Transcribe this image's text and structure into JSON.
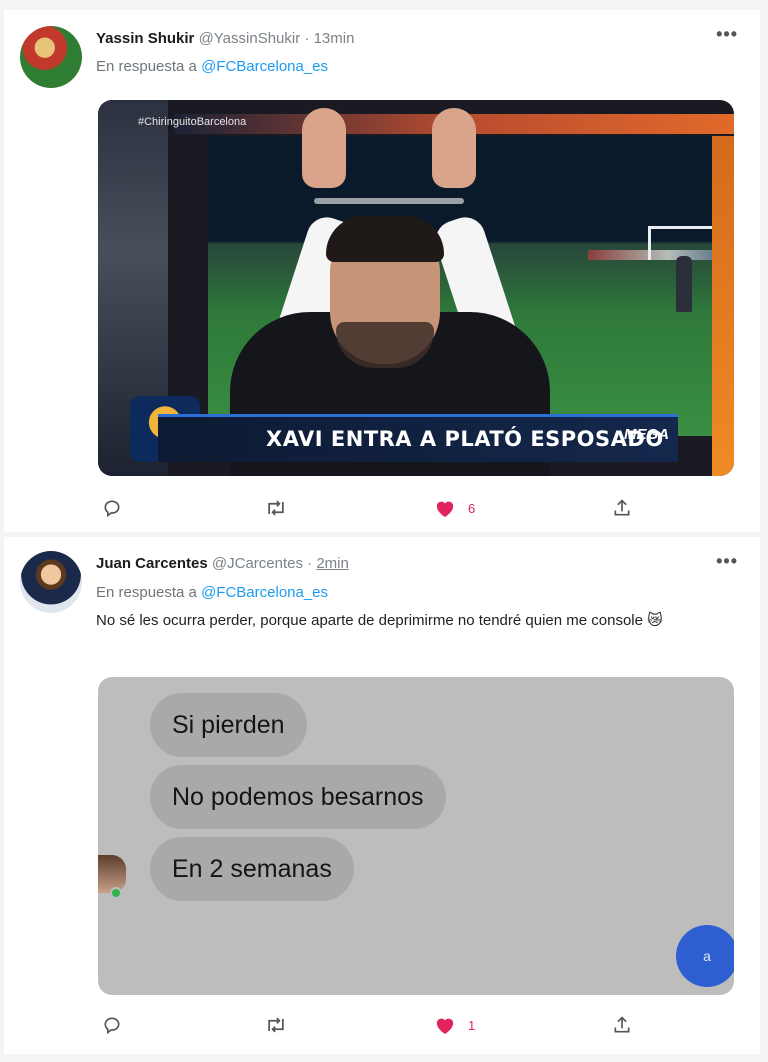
{
  "tweets": [
    {
      "author_name": "Yassin Shukir",
      "handle": "@YassinShukir",
      "separator": "·",
      "time": "13min",
      "reply_prefix": "En respuesta a",
      "reply_mention": "@FCBarcelona_es",
      "media": {
        "top_tag": "#ChiringuitoBarcelona",
        "banner_text": "XAVI ENTRA A PLATÓ ESPOSADO",
        "network": "MEGA"
      },
      "like_count": "6"
    },
    {
      "author_name": "Juan Carcentes",
      "handle": "@JCarcentes",
      "separator": "·",
      "time": "2min",
      "reply_prefix": "En respuesta a",
      "reply_mention": "@FCBarcelona_es",
      "body": "No sé les ocurra perder, porque aparte de deprimirme no tendré quien me console 😿",
      "chat_bubbles": [
        "Si pierden",
        "No podemos besarnos",
        "En 2 semanas"
      ],
      "fab_label": "a",
      "like_count": "1"
    }
  ],
  "icons": {
    "more": "more-icon",
    "reply": "reply-icon",
    "retweet": "retweet-icon",
    "like": "heart-icon",
    "share": "share-icon"
  },
  "colors": {
    "mention": "#1d9bf0",
    "like": "#e0245e",
    "muted": "#7b8288"
  }
}
